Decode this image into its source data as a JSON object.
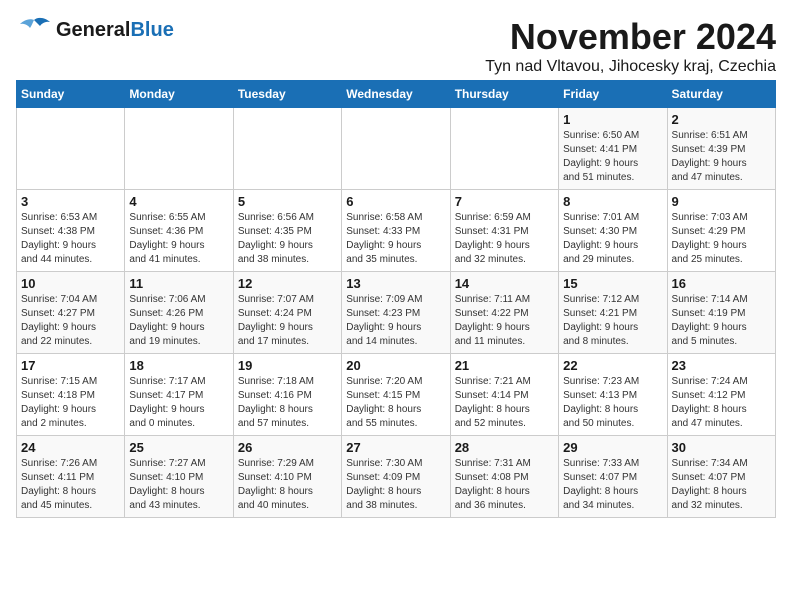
{
  "logo": {
    "general": "General",
    "blue": "Blue"
  },
  "title": "November 2024",
  "subtitle": "Tyn nad Vltavou, Jihocesky kraj, Czechia",
  "headers": [
    "Sunday",
    "Monday",
    "Tuesday",
    "Wednesday",
    "Thursday",
    "Friday",
    "Saturday"
  ],
  "rows": [
    [
      {
        "day": "",
        "info": ""
      },
      {
        "day": "",
        "info": ""
      },
      {
        "day": "",
        "info": ""
      },
      {
        "day": "",
        "info": ""
      },
      {
        "day": "",
        "info": ""
      },
      {
        "day": "1",
        "info": "Sunrise: 6:50 AM\nSunset: 4:41 PM\nDaylight: 9 hours\nand 51 minutes."
      },
      {
        "day": "2",
        "info": "Sunrise: 6:51 AM\nSunset: 4:39 PM\nDaylight: 9 hours\nand 47 minutes."
      }
    ],
    [
      {
        "day": "3",
        "info": "Sunrise: 6:53 AM\nSunset: 4:38 PM\nDaylight: 9 hours\nand 44 minutes."
      },
      {
        "day": "4",
        "info": "Sunrise: 6:55 AM\nSunset: 4:36 PM\nDaylight: 9 hours\nand 41 minutes."
      },
      {
        "day": "5",
        "info": "Sunrise: 6:56 AM\nSunset: 4:35 PM\nDaylight: 9 hours\nand 38 minutes."
      },
      {
        "day": "6",
        "info": "Sunrise: 6:58 AM\nSunset: 4:33 PM\nDaylight: 9 hours\nand 35 minutes."
      },
      {
        "day": "7",
        "info": "Sunrise: 6:59 AM\nSunset: 4:31 PM\nDaylight: 9 hours\nand 32 minutes."
      },
      {
        "day": "8",
        "info": "Sunrise: 7:01 AM\nSunset: 4:30 PM\nDaylight: 9 hours\nand 29 minutes."
      },
      {
        "day": "9",
        "info": "Sunrise: 7:03 AM\nSunset: 4:29 PM\nDaylight: 9 hours\nand 25 minutes."
      }
    ],
    [
      {
        "day": "10",
        "info": "Sunrise: 7:04 AM\nSunset: 4:27 PM\nDaylight: 9 hours\nand 22 minutes."
      },
      {
        "day": "11",
        "info": "Sunrise: 7:06 AM\nSunset: 4:26 PM\nDaylight: 9 hours\nand 19 minutes."
      },
      {
        "day": "12",
        "info": "Sunrise: 7:07 AM\nSunset: 4:24 PM\nDaylight: 9 hours\nand 17 minutes."
      },
      {
        "day": "13",
        "info": "Sunrise: 7:09 AM\nSunset: 4:23 PM\nDaylight: 9 hours\nand 14 minutes."
      },
      {
        "day": "14",
        "info": "Sunrise: 7:11 AM\nSunset: 4:22 PM\nDaylight: 9 hours\nand 11 minutes."
      },
      {
        "day": "15",
        "info": "Sunrise: 7:12 AM\nSunset: 4:21 PM\nDaylight: 9 hours\nand 8 minutes."
      },
      {
        "day": "16",
        "info": "Sunrise: 7:14 AM\nSunset: 4:19 PM\nDaylight: 9 hours\nand 5 minutes."
      }
    ],
    [
      {
        "day": "17",
        "info": "Sunrise: 7:15 AM\nSunset: 4:18 PM\nDaylight: 9 hours\nand 2 minutes."
      },
      {
        "day": "18",
        "info": "Sunrise: 7:17 AM\nSunset: 4:17 PM\nDaylight: 9 hours\nand 0 minutes."
      },
      {
        "day": "19",
        "info": "Sunrise: 7:18 AM\nSunset: 4:16 PM\nDaylight: 8 hours\nand 57 minutes."
      },
      {
        "day": "20",
        "info": "Sunrise: 7:20 AM\nSunset: 4:15 PM\nDaylight: 8 hours\nand 55 minutes."
      },
      {
        "day": "21",
        "info": "Sunrise: 7:21 AM\nSunset: 4:14 PM\nDaylight: 8 hours\nand 52 minutes."
      },
      {
        "day": "22",
        "info": "Sunrise: 7:23 AM\nSunset: 4:13 PM\nDaylight: 8 hours\nand 50 minutes."
      },
      {
        "day": "23",
        "info": "Sunrise: 7:24 AM\nSunset: 4:12 PM\nDaylight: 8 hours\nand 47 minutes."
      }
    ],
    [
      {
        "day": "24",
        "info": "Sunrise: 7:26 AM\nSunset: 4:11 PM\nDaylight: 8 hours\nand 45 minutes."
      },
      {
        "day": "25",
        "info": "Sunrise: 7:27 AM\nSunset: 4:10 PM\nDaylight: 8 hours\nand 43 minutes."
      },
      {
        "day": "26",
        "info": "Sunrise: 7:29 AM\nSunset: 4:10 PM\nDaylight: 8 hours\nand 40 minutes."
      },
      {
        "day": "27",
        "info": "Sunrise: 7:30 AM\nSunset: 4:09 PM\nDaylight: 8 hours\nand 38 minutes."
      },
      {
        "day": "28",
        "info": "Sunrise: 7:31 AM\nSunset: 4:08 PM\nDaylight: 8 hours\nand 36 minutes."
      },
      {
        "day": "29",
        "info": "Sunrise: 7:33 AM\nSunset: 4:07 PM\nDaylight: 8 hours\nand 34 minutes."
      },
      {
        "day": "30",
        "info": "Sunrise: 7:34 AM\nSunset: 4:07 PM\nDaylight: 8 hours\nand 32 minutes."
      }
    ]
  ]
}
